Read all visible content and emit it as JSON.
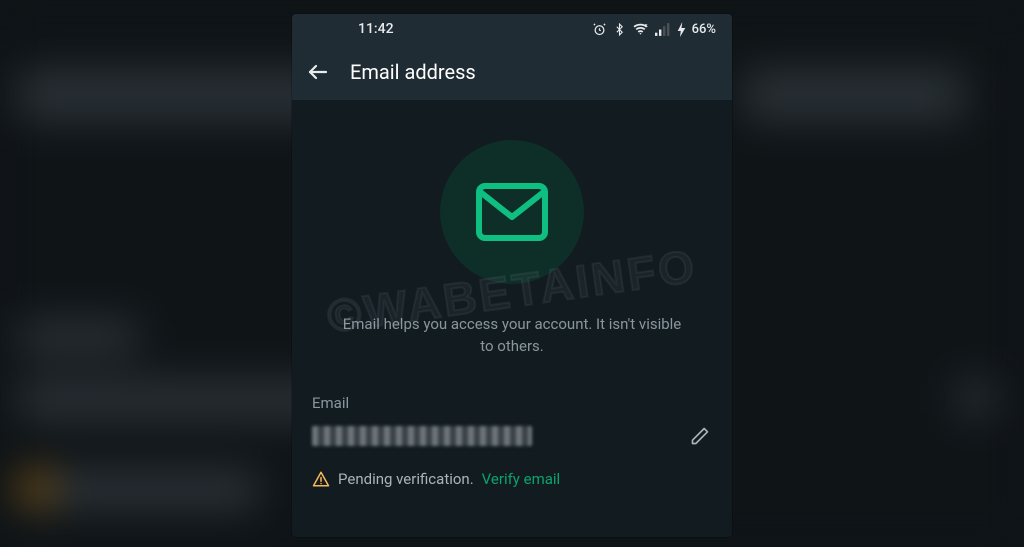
{
  "statusbar": {
    "time": "11:42",
    "battery": "66%"
  },
  "appbar": {
    "title": "Email address"
  },
  "description": "Email helps you access your account. It isn't visible to others.",
  "field": {
    "label": "Email"
  },
  "status": {
    "pending": "Pending verification.",
    "verify": "Verify email"
  },
  "watermark": "©WABETAINFO"
}
